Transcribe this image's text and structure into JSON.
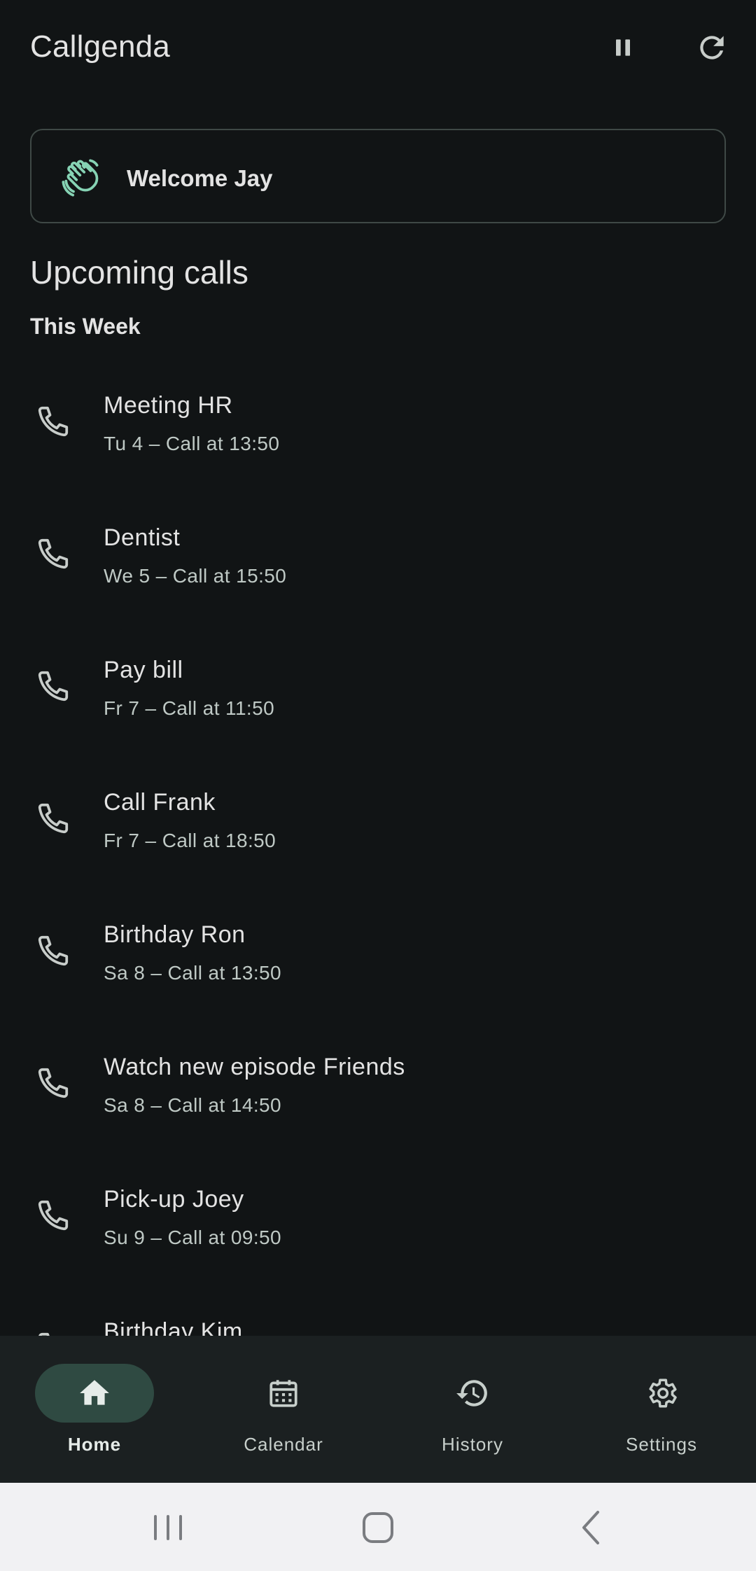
{
  "app": {
    "title": "Callgenda"
  },
  "actions": {
    "pause_icon": "pause-icon",
    "refresh_icon": "refresh-icon"
  },
  "welcome": {
    "text": "Welcome Jay",
    "icon": "waving-hand-icon"
  },
  "upcoming": {
    "title": "Upcoming calls",
    "group": "This Week",
    "calls": [
      {
        "title": "Meeting HR",
        "subtitle": "Tu 4 – Call at 13:50"
      },
      {
        "title": "Dentist",
        "subtitle": "We 5 – Call at 15:50"
      },
      {
        "title": "Pay bill",
        "subtitle": "Fr 7 – Call at 11:50"
      },
      {
        "title": "Call Frank",
        "subtitle": "Fr 7 – Call at 18:50"
      },
      {
        "title": "Birthday Ron",
        "subtitle": "Sa 8 – Call at 13:50"
      },
      {
        "title": "Watch new episode Friends",
        "subtitle": "Sa 8 – Call at 14:50"
      },
      {
        "title": "Pick-up Joey",
        "subtitle": "Su 9 – Call at 09:50"
      },
      {
        "title": "Birthday Kim",
        "subtitle": ""
      }
    ]
  },
  "nav": {
    "items": [
      {
        "label": "Home",
        "icon": "home-icon",
        "active": true
      },
      {
        "label": "Calendar",
        "icon": "calendar-icon",
        "active": false
      },
      {
        "label": "History",
        "icon": "history-icon",
        "active": false
      },
      {
        "label": "Settings",
        "icon": "gear-icon",
        "active": false
      }
    ]
  },
  "colors": {
    "background": "#111415",
    "accent": "#86d3b4",
    "nav_active_pill": "#2f4a42",
    "nav_bar": "#1b2021"
  }
}
